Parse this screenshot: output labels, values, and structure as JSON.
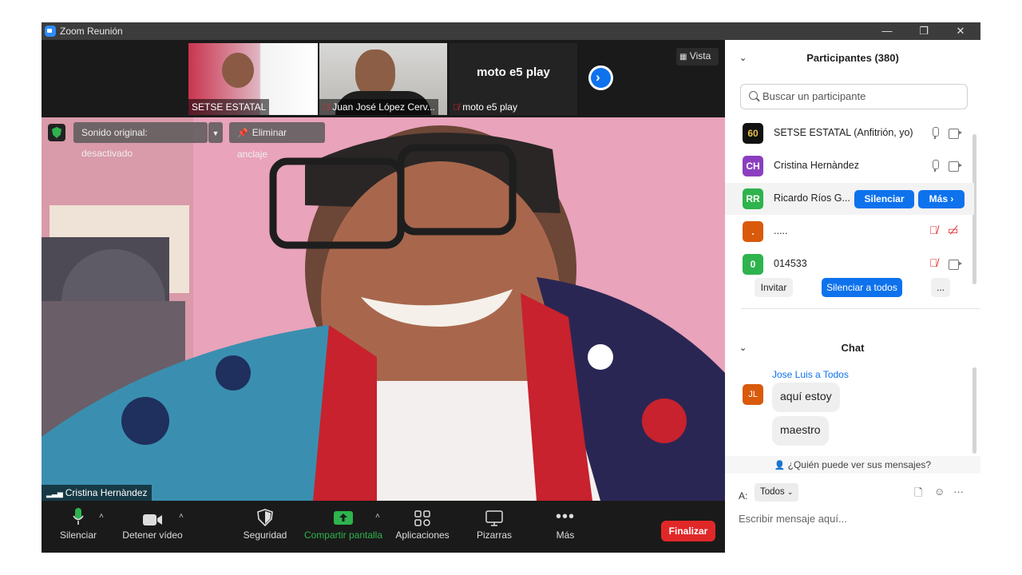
{
  "window": {
    "title": "Zoom Reunión",
    "minimize": "—",
    "restore": "❐",
    "close": "✕"
  },
  "strip": {
    "thumbs": [
      {
        "name": "SETSE ESTATAL",
        "muted": false
      },
      {
        "name": "Juan José López Cerv...",
        "muted": true
      },
      {
        "name": "moto e5 play",
        "muted": true
      }
    ],
    "video_off_label": "moto e5 play",
    "vista_label": "Vista"
  },
  "main": {
    "sound_label": "Sonido original: desactivado",
    "unpin_label": "Eliminar anclaje",
    "name_tag": "Cristina Hernàndez"
  },
  "toolbar": {
    "mute": "Silenciar",
    "video": "Detener vídeo",
    "security": "Seguridad",
    "share": "Compartir pantalla",
    "apps": "Aplicaciones",
    "whiteboards": "Pizarras",
    "more": "Más",
    "end": "Finalizar"
  },
  "participants": {
    "title": "Participantes (380)",
    "search_placeholder": "Buscar un participante",
    "list": [
      {
        "initials": "60",
        "name": "SETSE ESTATAL (Anfitrión, yo)",
        "color": "#111111"
      },
      {
        "initials": "CH",
        "name": "Cristina Hernàndez",
        "color": "#8b3fbf"
      },
      {
        "initials": "RR",
        "name": "Ricardo Ríos G...",
        "color": "#2eb34d"
      },
      {
        "initials": ".",
        "name": ".....",
        "color": "#d95a0b"
      },
      {
        "initials": "0",
        "name": "014533",
        "color": "#2eb34d"
      }
    ],
    "mute_button": "Silenciar",
    "more_button": "Más ›",
    "invite": "Invitar",
    "mute_all": "Silenciar a todos",
    "ellipsis": "..."
  },
  "chat": {
    "title": "Chat",
    "from": "Jose Luis a Todos",
    "sender_initials": "JL",
    "messages": [
      "aquí estoy",
      "maestro"
    ],
    "who_can_see": "¿Quién puede ver sus mensajes?",
    "to_label": "A:",
    "to_value": "Todos",
    "compose_placeholder": "Escribir mensaje aquí..."
  },
  "colors": {
    "accent": "#0e72ed",
    "end": "#e02828",
    "share": "#2eb34d"
  }
}
